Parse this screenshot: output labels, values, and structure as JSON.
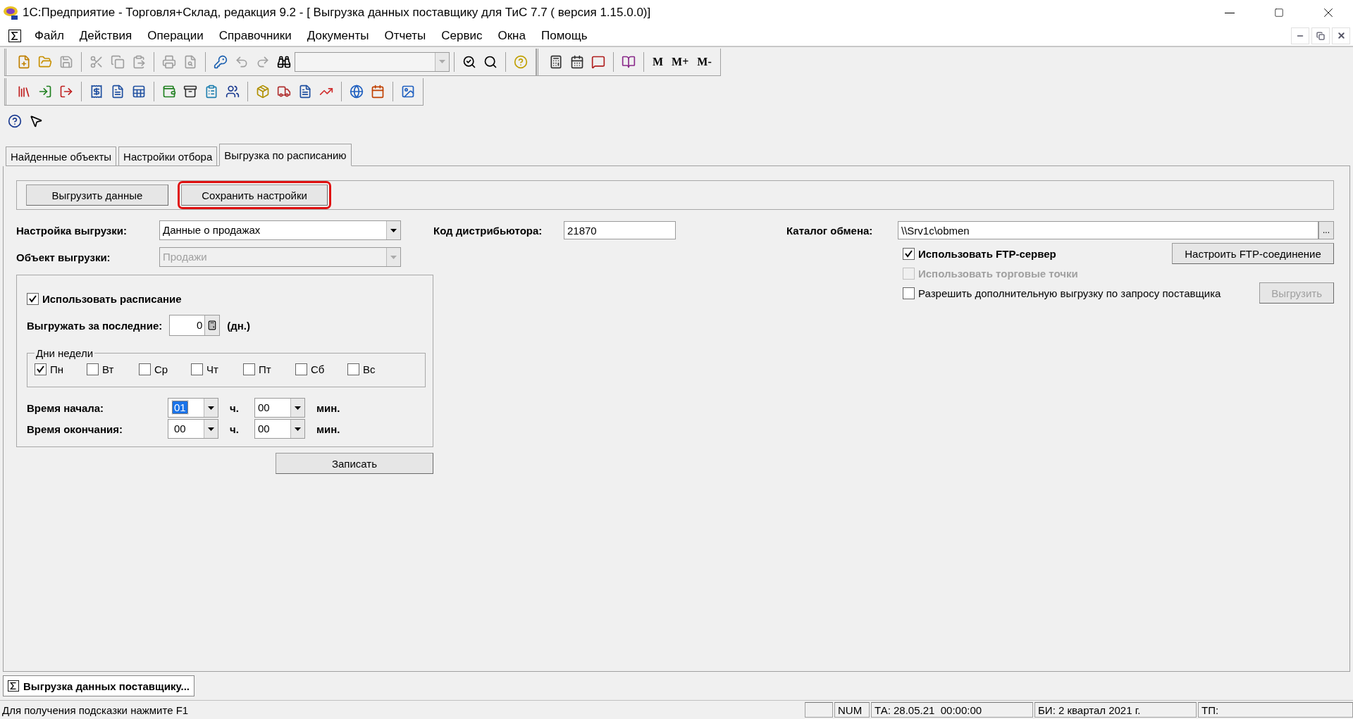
{
  "window": {
    "title": "1С:Предприятие - Торговля+Склад, редакция 9.2 - [ Выгрузка данных поставщику для ТиС 7.7 ( версия 1.15.0.0)]"
  },
  "menu": [
    "Файл",
    "Действия",
    "Операции",
    "Справочники",
    "Документы",
    "Отчеты",
    "Сервис",
    "Окна",
    "Помощь"
  ],
  "toolbar": {
    "memory_buttons": [
      "M",
      "M+",
      "M-"
    ]
  },
  "tabs": [
    {
      "label": "Найденные объекты",
      "selected": false
    },
    {
      "label": "Настройки отбора",
      "selected": false
    },
    {
      "label": "Выгрузка по расписанию",
      "selected": true
    }
  ],
  "action_buttons": [
    {
      "label": "Выгрузить данные",
      "highlighted": false
    },
    {
      "label": "Сохранить настройки",
      "highlighted": true
    }
  ],
  "export_setting": {
    "label": "Настройка выгрузки:",
    "value": "Данные о продажах",
    "disabled": false
  },
  "export_object": {
    "label": "Объект выгрузки:",
    "value": "Продажи",
    "disabled": true
  },
  "distributor_code": {
    "label": "Код дистрибьютора:",
    "value": "21870"
  },
  "exchange_dir": {
    "label": "Каталог обмена:",
    "value": "\\\\Srv1c\\obmen",
    "browse": "..."
  },
  "options": [
    {
      "label": "Использовать FTP-сервер",
      "checked": true,
      "disabled": false,
      "bold": true,
      "button": {
        "label": "Настроить FTP-соединение",
        "disabled": false
      }
    },
    {
      "label": "Использовать торговые точки",
      "checked": false,
      "disabled": true,
      "bold": true
    },
    {
      "label": "Разрешить дополнительную выгрузку по запросу поставщика",
      "checked": false,
      "disabled": false,
      "bold": false,
      "button": {
        "label": "Выгрузить",
        "disabled": true
      }
    }
  ],
  "schedule": {
    "use": {
      "label": "Использовать расписание",
      "checked": true
    },
    "days_back": {
      "label": "Выгружать за последние:",
      "value": "0",
      "unit": "(дн.)"
    },
    "weekdays": {
      "title": "Дни недели",
      "days": [
        {
          "label": "Пн",
          "checked": true
        },
        {
          "label": "Вт",
          "checked": false
        },
        {
          "label": "Ср",
          "checked": false
        },
        {
          "label": "Чт",
          "checked": false
        },
        {
          "label": "Пт",
          "checked": false
        },
        {
          "label": "Сб",
          "checked": false
        },
        {
          "label": "Вс",
          "checked": false
        }
      ]
    },
    "times": [
      {
        "label": "Время начала:",
        "hour": "01",
        "hour_selected": true,
        "hour_unit": "ч.",
        "minute": "00",
        "minute_unit": "мин."
      },
      {
        "label": "Время окончания:",
        "hour": "00",
        "hour_selected": false,
        "hour_unit": "ч.",
        "minute": "00",
        "minute_unit": "мин."
      }
    ]
  },
  "save_button": "Записать",
  "taskbar": [
    {
      "label": "Выгрузка данных поставщику...",
      "selected": true
    }
  ],
  "status_bar": {
    "hint": "Для получения подсказки нажмите F1",
    "panels": [
      "NUM",
      "ТА: 28.05.21  00:00:00",
      "БИ: 2 квартал 2021 г.",
      "ТП:"
    ]
  }
}
